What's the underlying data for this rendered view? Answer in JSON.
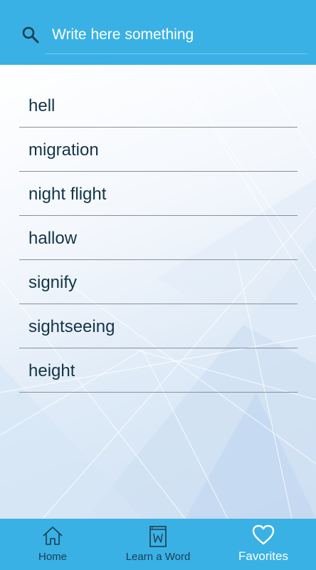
{
  "search": {
    "placeholder": "Write here something",
    "icon": "search-icon"
  },
  "words": [
    {
      "label": "hell"
    },
    {
      "label": "migration"
    },
    {
      "label": "night flight"
    },
    {
      "label": "hallow"
    },
    {
      "label": "signify"
    },
    {
      "label": "sightseeing"
    },
    {
      "label": "height"
    }
  ],
  "bottom_nav": {
    "home": {
      "label": "Home",
      "icon": "home-icon"
    },
    "learn": {
      "label": "Learn a Word",
      "icon": "book-icon"
    },
    "favorites": {
      "label": "Favorites",
      "icon": "heart-icon",
      "active": true
    }
  },
  "colors": {
    "accent": "#3ab1e4",
    "text": "#133547",
    "nav_text": "#1d3d52",
    "active_nav_text": "#ffffff"
  }
}
